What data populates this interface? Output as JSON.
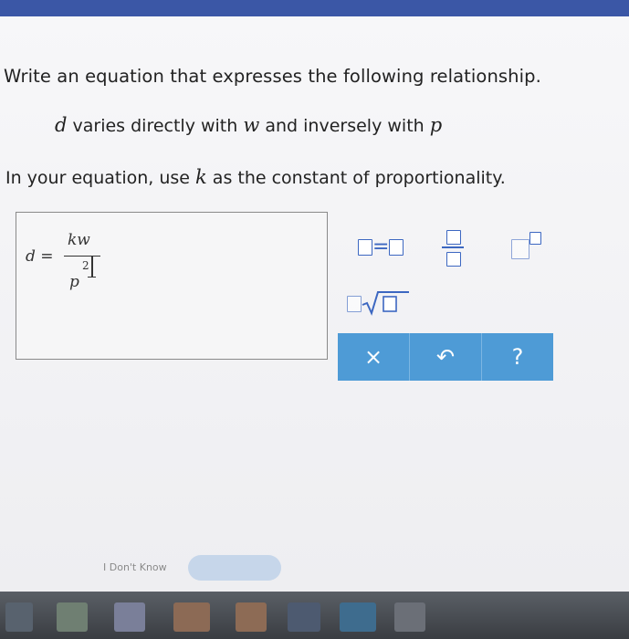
{
  "question": {
    "prompt": "Write an equation that expresses the following relationship.",
    "relationship": {
      "var_d": "d",
      "text_1": " varies directly with ",
      "var_w": "w",
      "text_2": " and inversely with ",
      "var_p": "p"
    },
    "instruction": {
      "text_1": "In your equation, use ",
      "var_k": "k",
      "text_2": " as the constant of proportionality."
    }
  },
  "answer": {
    "lhs_var": "d",
    "equals": "=",
    "numerator": "kw",
    "denominator": "p",
    "exponent": "2"
  },
  "palette": {
    "tools": [
      "equals-template",
      "fraction-template",
      "power-template",
      "sqrt-template"
    ],
    "equals_sign": "="
  },
  "actions": {
    "clear": "×",
    "undo": "↶",
    "help": "?"
  },
  "footer": {
    "dont_know": "I Don't Know"
  },
  "colors": {
    "accent": "#4e9bd6",
    "template_blue": "#3c67c1",
    "topbar": "#3b57a6"
  }
}
